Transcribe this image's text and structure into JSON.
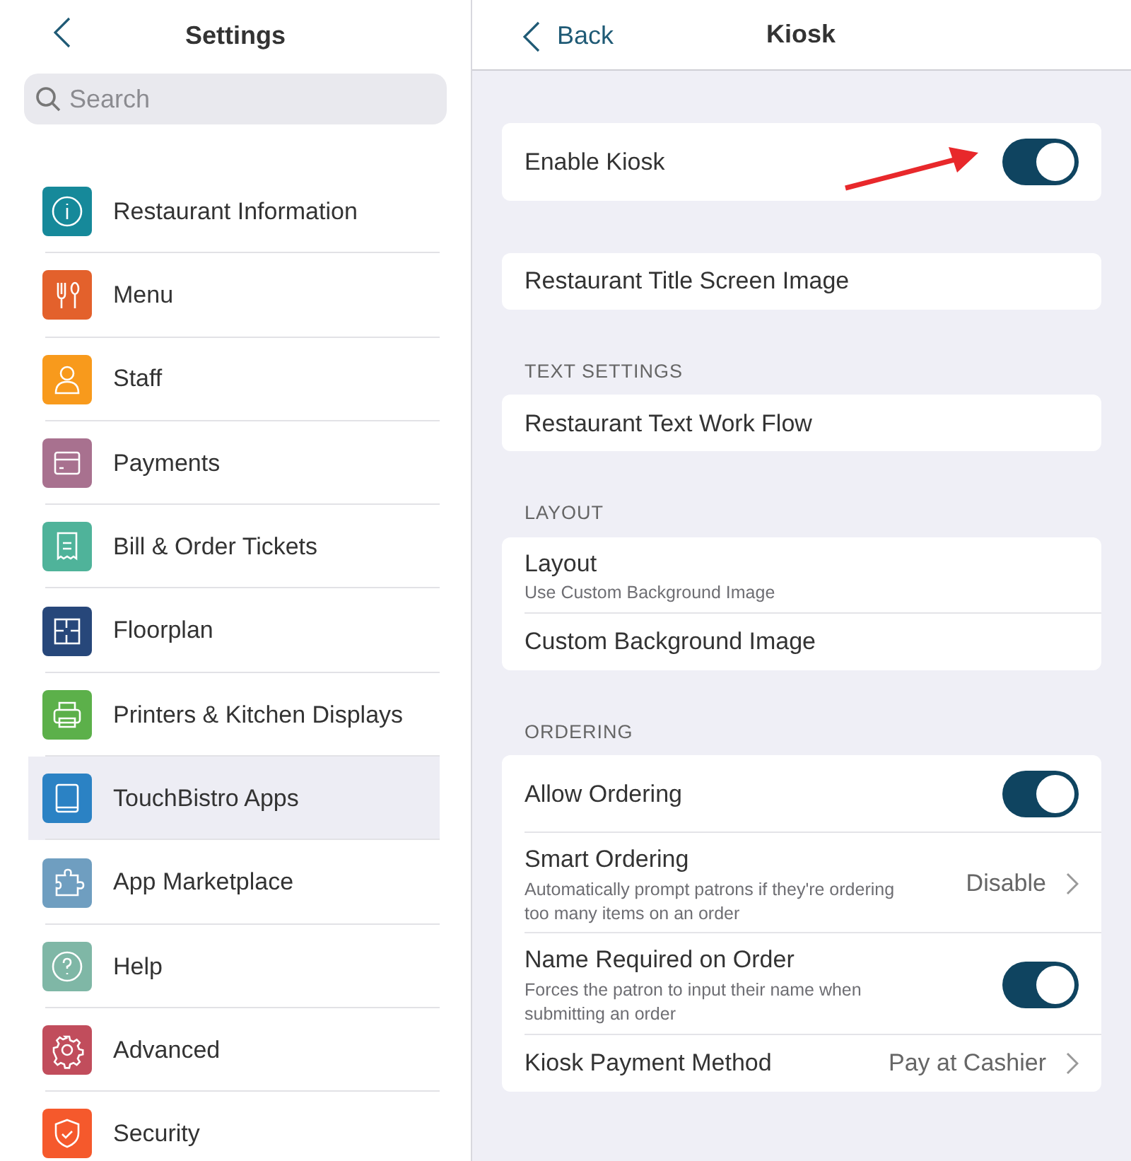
{
  "sidebar": {
    "title": "Settings",
    "search": {
      "placeholder": "Search"
    },
    "items": [
      {
        "label": "Restaurant Information",
        "color": "#16899a",
        "selected": false
      },
      {
        "label": "Menu",
        "color": "#e3612c",
        "selected": false
      },
      {
        "label": "Staff",
        "color": "#f89a1c",
        "selected": false
      },
      {
        "label": "Payments",
        "color": "#a8718f",
        "selected": false
      },
      {
        "label": "Bill & Order Tickets",
        "color": "#4fb39a",
        "selected": false
      },
      {
        "label": "Floorplan",
        "color": "#27477a",
        "selected": false
      },
      {
        "label": "Printers & Kitchen Displays",
        "color": "#5cb04a",
        "selected": false
      },
      {
        "label": "TouchBistro Apps",
        "color": "#2b82c4",
        "selected": true
      },
      {
        "label": "App Marketplace",
        "color": "#6f9ec0",
        "selected": false
      },
      {
        "label": "Help",
        "color": "#7fb7a6",
        "selected": false
      },
      {
        "label": "Advanced",
        "color": "#c14d5c",
        "selected": false
      },
      {
        "label": "Security",
        "color": "#f5592c",
        "selected": false
      }
    ]
  },
  "detail": {
    "back": "Back",
    "title": "Kiosk",
    "sections": [
      {
        "rows": [
          {
            "kind": "toggle",
            "label": "Enable Kiosk",
            "on": true,
            "annotated": true
          }
        ]
      },
      {
        "rows": [
          {
            "kind": "plain",
            "label": "Restaurant Title Screen Image"
          }
        ]
      },
      {
        "header": "TEXT SETTINGS",
        "rows": [
          {
            "kind": "plain",
            "label": "Restaurant Text Work Flow"
          }
        ]
      },
      {
        "header": "LAYOUT",
        "rows": [
          {
            "kind": "plain",
            "label": "Layout",
            "subtitle": "Use Custom Background Image"
          },
          {
            "kind": "plain",
            "label": "Custom Background Image"
          }
        ]
      },
      {
        "header": "ORDERING",
        "rows": [
          {
            "kind": "toggle",
            "label": "Allow Ordering",
            "on": true
          },
          {
            "kind": "nav",
            "label": "Smart Ordering",
            "subtitle": "Automatically prompt patrons if they're ordering too many items on an order",
            "value": "Disable"
          },
          {
            "kind": "toggle",
            "label": "Name Required on Order",
            "subtitle": "Forces the patron to input their name when submitting an order",
            "on": true
          },
          {
            "kind": "nav",
            "label": "Kiosk Payment Method",
            "value": "Pay at Cashier"
          }
        ]
      }
    ]
  }
}
